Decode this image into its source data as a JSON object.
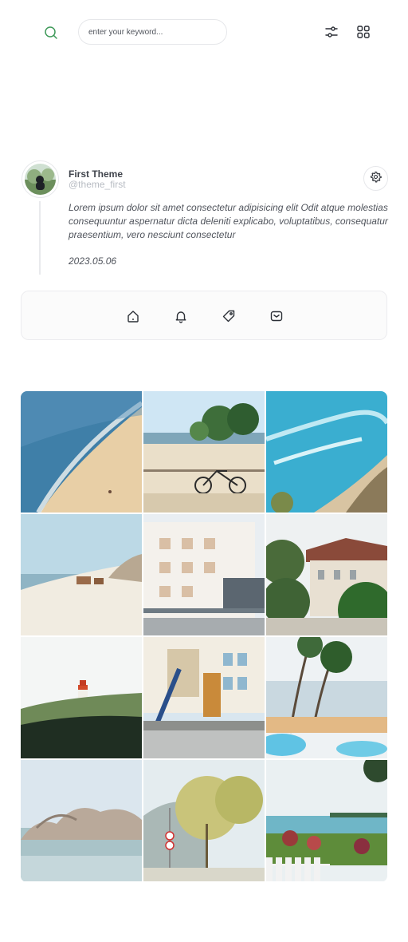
{
  "search": {
    "placeholder": "enter your keyword..."
  },
  "profile": {
    "name": "First Theme",
    "handle": "@theme_first",
    "bio": "Lorem ipsum dolor sit amet consectetur adipisicing elit Odit atque molestias consequuntur aspernatur dicta deleniti explicabo, voluptatibus, consequatur praesentium, vero nesciunt consectetur",
    "date": "2023.05.06"
  },
  "icons": {
    "search": "search-icon",
    "filter": "sliders-icon",
    "apps": "grid-icon",
    "settings": "gear-icon",
    "nav": [
      "home-icon",
      "bell-icon",
      "tag-icon",
      "mail-icon"
    ]
  },
  "colors": {
    "accent": "#3f9a5a",
    "icon": "#2b2f36",
    "border": "#e6e7ea"
  },
  "gallery": {
    "photos": [
      "aerial beach",
      "beach with bicycle",
      "turquoise coast",
      "white dunes with huts",
      "white apartment building",
      "villa behind trees",
      "red lighthouse",
      "building with stairs",
      "palm trees and pool",
      "rocks in sea",
      "tree-lined road",
      "lakeside garden"
    ]
  }
}
